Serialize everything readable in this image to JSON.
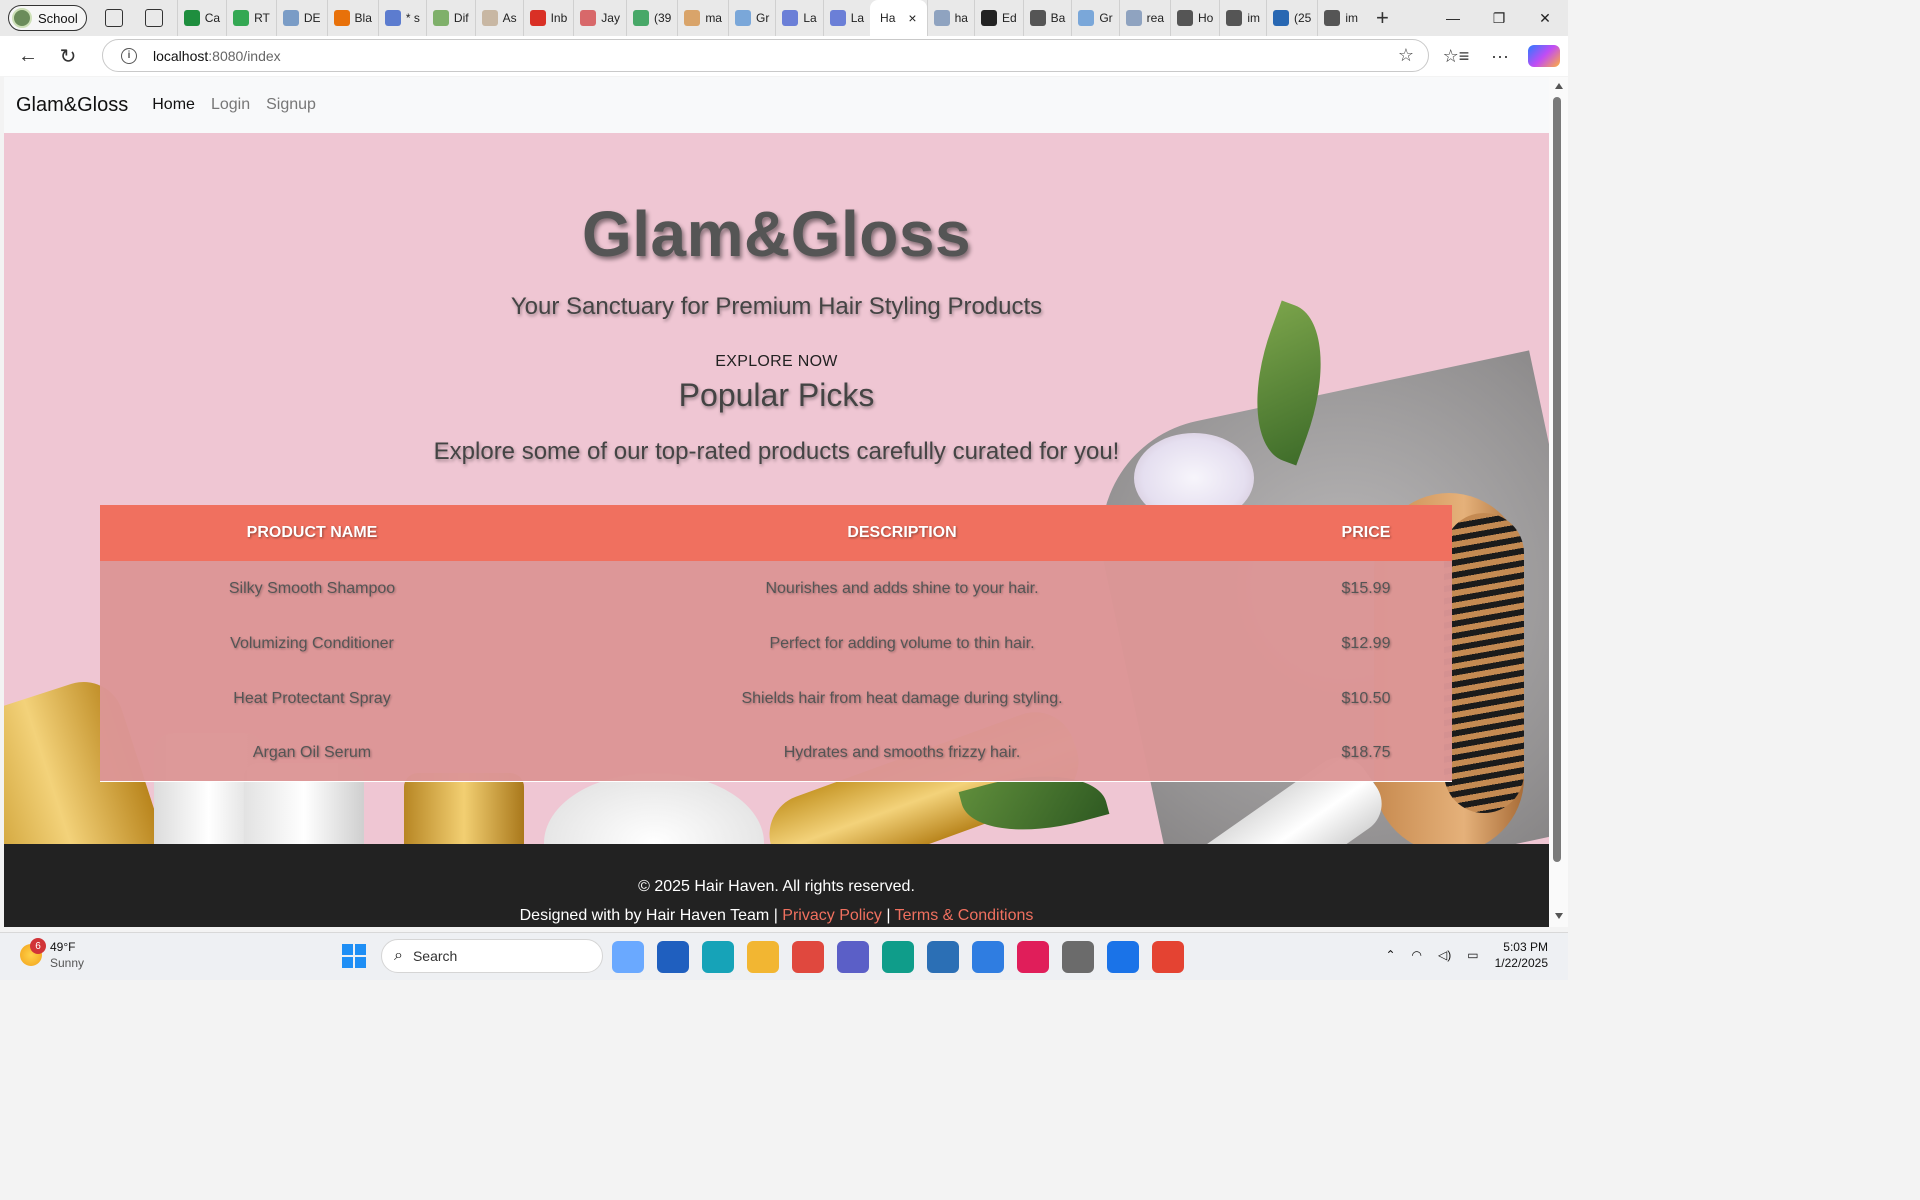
{
  "browser": {
    "profile_label": "School",
    "tabs": [
      {
        "label": "Ca",
        "color": "#1e8e3e"
      },
      {
        "label": "RT",
        "color": "#34a853"
      },
      {
        "label": "DE",
        "color": "#7a9cc6"
      },
      {
        "label": "Bla",
        "color": "#e8710a"
      },
      {
        "label": "* s",
        "color": "#5c7ccf"
      },
      {
        "label": "Dif",
        "color": "#7fb06a"
      },
      {
        "label": "As",
        "color": "#c8b7a3"
      },
      {
        "label": "Inb",
        "color": "#d93025"
      },
      {
        "label": "Jay",
        "color": "#d8686a"
      },
      {
        "label": "(39",
        "color": "#48a868"
      },
      {
        "label": "ma",
        "color": "#d9a46a"
      },
      {
        "label": "Gr",
        "color": "#7aa7d9"
      },
      {
        "label": "La",
        "color": "#6b7fd7"
      },
      {
        "label": "La",
        "color": "#6b7fd7"
      }
    ],
    "active_tab": {
      "label": "Ha",
      "close": "×"
    },
    "tabs_after": [
      {
        "label": "ha",
        "color": "#8fa3c0"
      },
      {
        "label": "Ed",
        "color": "#222222"
      },
      {
        "label": "Ba",
        "color": "#555555"
      },
      {
        "label": "Gr",
        "color": "#7aa7d9"
      },
      {
        "label": "rea",
        "color": "#8fa3c0"
      },
      {
        "label": "Ho",
        "color": "#555555"
      },
      {
        "label": "im",
        "color": "#555555"
      },
      {
        "label": "(25",
        "color": "#2867b2"
      },
      {
        "label": "im",
        "color": "#555555"
      }
    ],
    "new_tab": "+",
    "window_controls": {
      "minimize": "—",
      "restore": "❐",
      "close": "✕"
    },
    "back": "←",
    "reload": "↻",
    "url_host": "localhost",
    "url_path": ":8080/index",
    "favorite_star": "☆",
    "favorites": "☆≡",
    "more": "···"
  },
  "site": {
    "brand": "Glam&Gloss",
    "nav": [
      {
        "label": "Home",
        "current": true
      },
      {
        "label": "Login",
        "current": false
      },
      {
        "label": "Signup",
        "current": false
      }
    ],
    "hero": {
      "title": "Glam&Gloss",
      "tagline": "Your Sanctuary for Premium Hair Styling Products",
      "explore": "EXPLORE NOW",
      "section_title": "Popular Picks",
      "section_sub": "Explore some of our top-rated products carefully curated for you!"
    },
    "table": {
      "headers": [
        "PRODUCT NAME",
        "DESCRIPTION",
        "PRICE"
      ],
      "rows": [
        [
          "Silky Smooth Shampoo",
          "Nourishes and adds shine to your hair.",
          "$15.99"
        ],
        [
          "Volumizing Conditioner",
          "Perfect for adding volume to thin hair.",
          "$12.99"
        ],
        [
          "Heat Protectant Spray",
          "Shields hair from heat damage during styling.",
          "$10.50"
        ],
        [
          "Argan Oil Serum",
          "Hydrates and smooths frizzy hair.",
          "$18.75"
        ]
      ]
    },
    "footer": {
      "copyright": "© 2025 Hair Haven. All rights reserved.",
      "designed_by": "Designed with by Hair Haven Team",
      "separator": "|",
      "privacy": "Privacy Policy",
      "terms": "Terms & Conditions"
    },
    "colors": {
      "accent": "#f0705f",
      "hero_bg": "#efc6d3",
      "footer_bg": "#222222"
    }
  },
  "taskbar": {
    "weather_temp": "49°F",
    "weather_desc": "Sunny",
    "weather_badge": "6",
    "search_label": "Search",
    "apps": [
      "copilot-icon",
      "store-icon",
      "app-icon",
      "explorer-icon",
      "chrome-icon",
      "teams-icon",
      "edge-icon",
      "vscode-icon",
      "notepad-icon",
      "slack-icon",
      "settings-icon",
      "maps-icon",
      "intellij-icon"
    ],
    "time": "5:03 PM",
    "date": "1/22/2025"
  }
}
